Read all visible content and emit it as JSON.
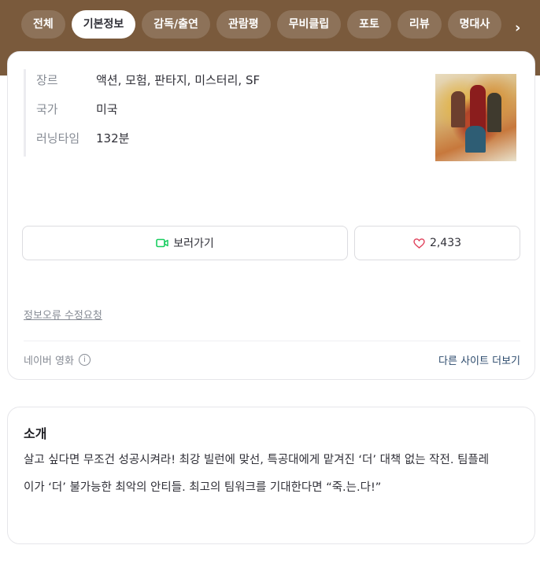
{
  "tabs": [
    {
      "label": "전체",
      "active": false
    },
    {
      "label": "기본정보",
      "active": true
    },
    {
      "label": "감독/출연",
      "active": false
    },
    {
      "label": "관람평",
      "active": false
    },
    {
      "label": "무비클립",
      "active": false
    },
    {
      "label": "포토",
      "active": false
    },
    {
      "label": "리뷰",
      "active": false
    },
    {
      "label": "명대사",
      "active": false
    }
  ],
  "info": {
    "genre_label": "장르",
    "genre_value": "액션, 모험, 판타지, 미스터리, SF",
    "country_label": "국가",
    "country_value": "미국",
    "runtime_label": "러닝타임",
    "runtime_value": "132분"
  },
  "actions": {
    "watch_label": "보러가기",
    "like_count": "2,433"
  },
  "report_link": "정보오류 수정요청",
  "footer": {
    "source": "네이버 영화",
    "more_sites": "다른 사이트 더보기"
  },
  "intro": {
    "title": "소개",
    "text": "살고 싶다면 무조건 성공시켜라! 최강 빌런에 맞선, 특공대에게 맡겨진 ‘더’ 대책 없는 작전. 팀플레이가 ‘더’ 불가능한 최악의 안티들. 최고의 팀워크를 기대한다면 “죽.는.다!”"
  },
  "colors": {
    "topbar": "#7a5a3c",
    "watch_icon": "#19ce60",
    "heart_icon": "#e0405a",
    "link": "#2c4a6c"
  }
}
